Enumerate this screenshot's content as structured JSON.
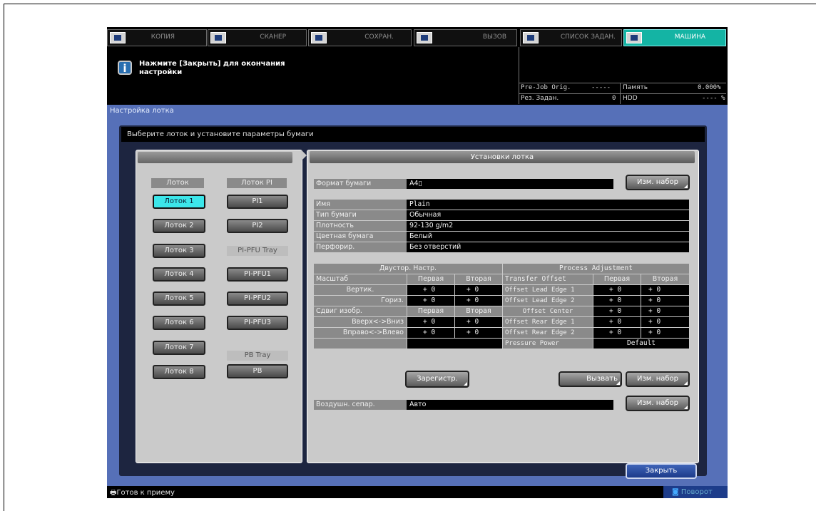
{
  "tabs": [
    {
      "label": "КОПИЯ"
    },
    {
      "label": "СКАНЕР"
    },
    {
      "label": "СОХРАН."
    },
    {
      "label": "ВЫЗОВ"
    },
    {
      "label": "СПИСОК ЗАДАН."
    },
    {
      "label": "МАШИНА"
    }
  ],
  "message": "Нажмите [Закрыть] для окончания настройки",
  "status": {
    "prejob_label": "Pre-Job Orig.",
    "prejob_value": "-----",
    "memory_label": "Память",
    "memory_value": "0.000%",
    "jobs_label": "Рез. Задан.",
    "jobs_value": "0",
    "hdd_label": "HDD",
    "hdd_value": "---- %"
  },
  "screen_title": "Настройка лотка",
  "instruction": "Выберите лоток и установите параметры бумаги",
  "left": {
    "col1_header": "Лоток",
    "col2_header": "Лоток PI",
    "trays": [
      "Лоток 1",
      "Лоток 2",
      "Лоток 3",
      "Лоток 4",
      "Лоток 5",
      "Лоток 6",
      "Лоток 7",
      "Лоток 8"
    ],
    "selected": "Лоток 1",
    "pi": [
      "PI1",
      "PI2"
    ],
    "pfu_tray_label": "PI-PFU Tray",
    "pfu": [
      "PI-PFU1",
      "PI-PFU2",
      "PI-PFU3"
    ],
    "pb_tray_label": "PB Tray",
    "pb": "PB"
  },
  "right": {
    "header": "Установки лотка",
    "paper_size_label": "Формат бумаги",
    "paper_size_value": "A4▯",
    "change_setting": "Изм. набор",
    "name_label": "Имя",
    "name_value": "Plain",
    "paper_type_label": "Тип бумаги",
    "paper_type_value": "Обычная",
    "weight_label": "Плотность",
    "weight_value": "92-130 g/m2",
    "color_label": "Цветная бумага",
    "color_value": "Белый",
    "punch_label": "Перфорир.",
    "punch_value": "Без отверстий",
    "duplex_header": "Двустор. Настр.",
    "scale_label": "Масштаб",
    "first": "Первая",
    "second": "Вторая",
    "vert_label": "Вертик.",
    "horiz_label": "Гориз.",
    "shift_label": "Сдвиг изобр.",
    "updown_label": "Вверх<->Вниз",
    "rightleft_label": "Вправо<->Влево",
    "zero": "+ 0",
    "process_header": "Process Adjustment",
    "transfer_offset": "Transfer Offset",
    "lead1": "Offset Lead Edge 1",
    "lead2": "Offset Lead Edge 2",
    "center": "Offset Center",
    "rear1": "Offset Rear Edge 1",
    "rear2": "Offset Rear Edge 2",
    "pressure_label": "Pressure Power",
    "pressure_value": "Default",
    "register_btn": "Зарегистр.",
    "recall_btn": "Вызвать",
    "air_label": "Воздушн. сепар.",
    "air_value": "Авто"
  },
  "close_btn": "Закрыть",
  "ready": "Готов к приему",
  "rotate": "Поворот"
}
